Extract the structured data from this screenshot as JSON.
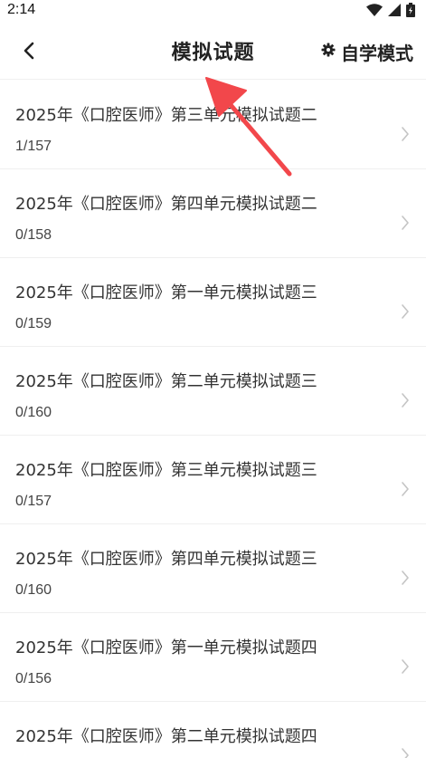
{
  "status_bar": {
    "time": "2:14",
    "icons": [
      "wifi-icon",
      "signal-icon",
      "battery-icon"
    ]
  },
  "header": {
    "title": "模拟试题",
    "back_icon": "chevron-left-icon",
    "mode_icon": "gear-icon",
    "mode_label": "自学模式"
  },
  "exam_list": [
    {
      "title": "2025年《口腔医师》第三单元模拟试题二",
      "progress": "1/157"
    },
    {
      "title": "2025年《口腔医师》第四单元模拟试题二",
      "progress": "0/158"
    },
    {
      "title": "2025年《口腔医师》第一单元模拟试题三",
      "progress": "0/159"
    },
    {
      "title": "2025年《口腔医师》第二单元模拟试题三",
      "progress": "0/160"
    },
    {
      "title": "2025年《口腔医师》第三单元模拟试题三",
      "progress": "0/157"
    },
    {
      "title": "2025年《口腔医师》第四单元模拟试题三",
      "progress": "0/160"
    },
    {
      "title": "2025年《口腔医师》第一单元模拟试题四",
      "progress": "0/156"
    },
    {
      "title": "2025年《口腔医师》第二单元模拟试题四",
      "progress": ""
    }
  ],
  "colors": {
    "annotation_arrow": "#f2474b",
    "divider": "#efefef",
    "chevron": "#c4c4c4"
  }
}
